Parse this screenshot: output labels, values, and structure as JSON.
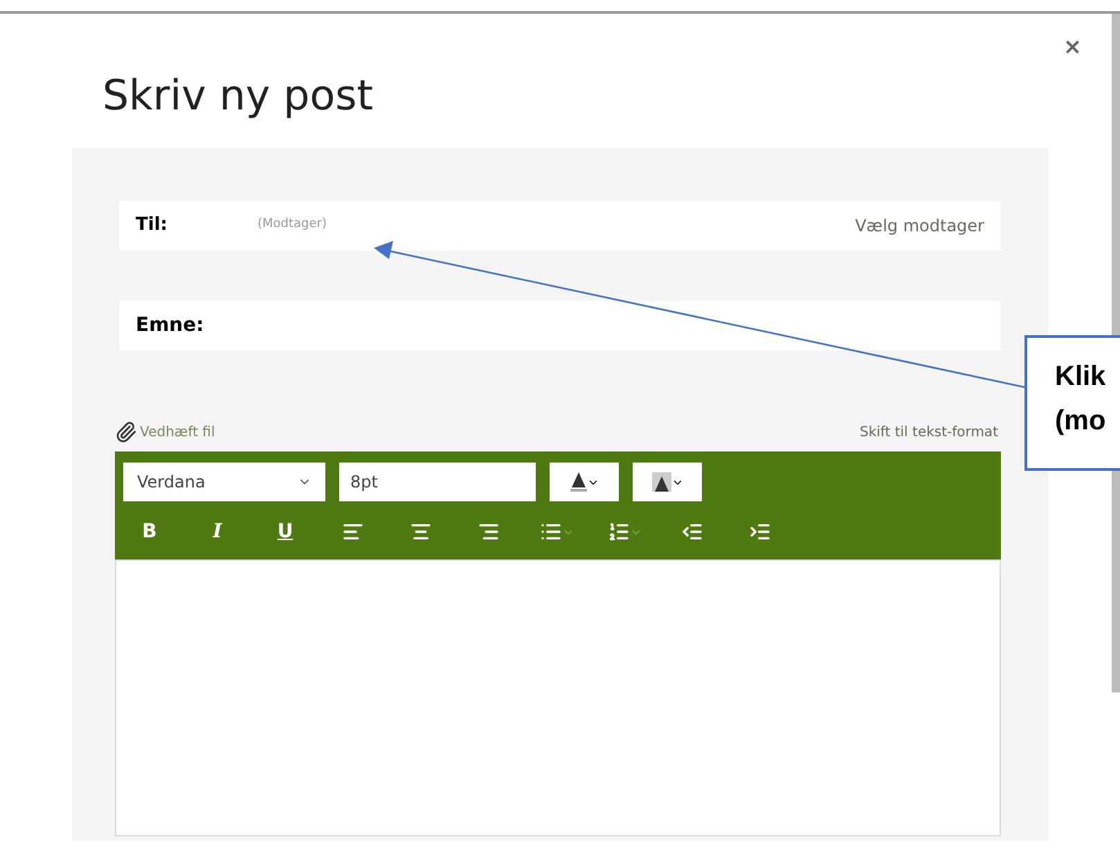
{
  "dialog": {
    "title": "Skriv ny post",
    "close": "×"
  },
  "to": {
    "label": "Til:",
    "placeholder": "(Modtager)",
    "action": "Vælg modtager"
  },
  "subject": {
    "label": "Emne:"
  },
  "attach": {
    "label": "Vedhæft fil",
    "switch": "Skift til tekst-format"
  },
  "toolbar": {
    "font": "Verdana",
    "size": "8pt",
    "format_buttons": [
      {
        "kind": "bold",
        "label": "B"
      },
      {
        "kind": "italic",
        "label": "I"
      },
      {
        "kind": "underline",
        "label": "U"
      },
      {
        "kind": "align-left"
      },
      {
        "kind": "align-center"
      },
      {
        "kind": "align-right"
      },
      {
        "kind": "bullets"
      },
      {
        "kind": "numbers"
      },
      {
        "kind": "outdent"
      },
      {
        "kind": "indent"
      }
    ]
  },
  "callout": {
    "lines": [
      "Klik",
      "(mo"
    ]
  }
}
